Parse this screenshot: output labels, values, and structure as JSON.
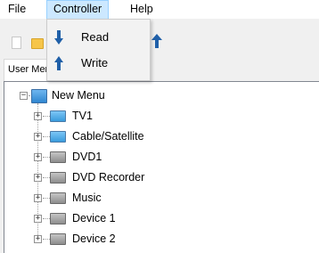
{
  "menubar": {
    "file": "File",
    "controller": "Controller",
    "help": "Help"
  },
  "dropdown": {
    "read": "Read",
    "write": "Write"
  },
  "tab": {
    "label": "User Menu"
  },
  "tree": {
    "root": "New Menu",
    "items": [
      {
        "label": "TV1",
        "icon": "tv-icon",
        "color": "blue"
      },
      {
        "label": "Cable/Satellite",
        "icon": "tv-icon",
        "color": "blue"
      },
      {
        "label": "DVD1",
        "icon": "device-icon",
        "color": "gray"
      },
      {
        "label": "DVD Recorder",
        "icon": "device-icon",
        "color": "gray"
      },
      {
        "label": "Music",
        "icon": "device-icon",
        "color": "gray"
      },
      {
        "label": "Device 1",
        "icon": "device-icon",
        "color": "gray"
      },
      {
        "label": "Device 2",
        "icon": "device-icon",
        "color": "gray"
      }
    ]
  },
  "colors": {
    "menu_highlight": "#cce8ff",
    "menu_highlight_border": "#99d1ff",
    "arrow_blue": "#1f5fa8"
  }
}
